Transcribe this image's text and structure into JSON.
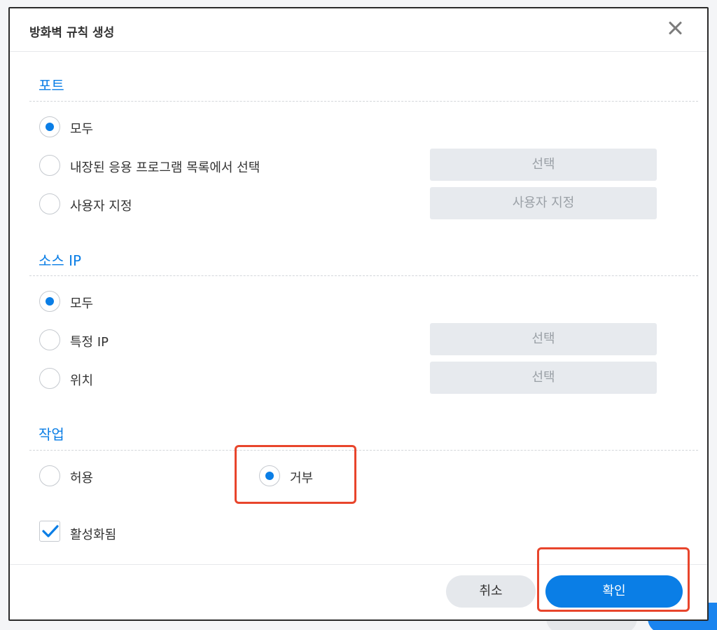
{
  "dialog": {
    "title": "방화벽 규칙 생성"
  },
  "port": {
    "title": "포트",
    "options": [
      {
        "label": "모두",
        "checked": true
      },
      {
        "label": "내장된 응용 프로그램 목록에서 선택",
        "checked": false,
        "button": "선택"
      },
      {
        "label": "사용자 지정",
        "checked": false,
        "button": "사용자 지정"
      }
    ]
  },
  "source_ip": {
    "title": "소스 IP",
    "options": [
      {
        "label": "모두",
        "checked": true
      },
      {
        "label": "특정 IP",
        "checked": false,
        "button": "선택"
      },
      {
        "label": "위치",
        "checked": false,
        "button": "선택"
      }
    ]
  },
  "action": {
    "title": "작업",
    "allow_label": "허용",
    "deny_label": "거부",
    "selected": "deny"
  },
  "enabled": {
    "label": "활성화됨",
    "checked": true
  },
  "footer": {
    "cancel_label": "취소",
    "confirm_label": "확인"
  },
  "colors": {
    "accent": "#0a7ee6",
    "highlight": "#e8452c"
  }
}
